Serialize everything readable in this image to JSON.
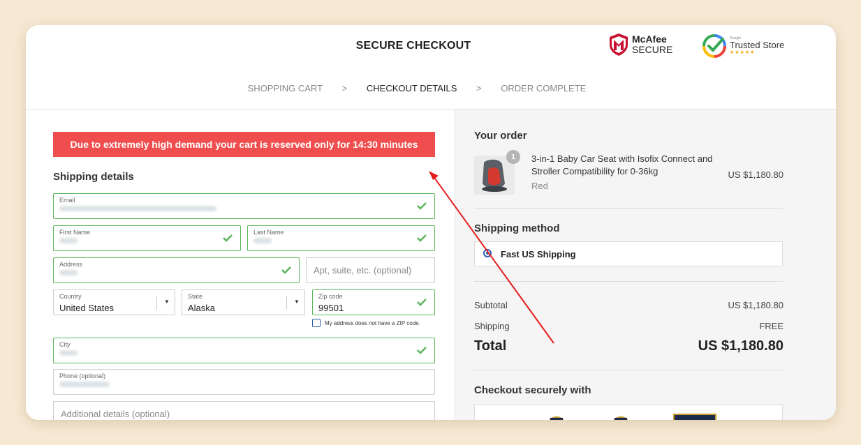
{
  "header": {
    "title": "SECURE CHECKOUT",
    "mcafee": {
      "line1": "McAfee",
      "line2": "SECURE",
      "icon": "mcafee-shield-icon"
    },
    "google": {
      "small": "Google",
      "line1": "Trusted Store",
      "stars": "★★★★★",
      "icon": "google-check-icon"
    }
  },
  "steps": [
    {
      "label": "SHOPPING CART"
    },
    {
      "label": ">"
    },
    {
      "label": "CHECKOUT DETAILS"
    },
    {
      "label": ">"
    },
    {
      "label": "ORDER COMPLETE"
    }
  ],
  "timer_text": "Due to extremely high demand your cart is reserved only for 14:30 minutes",
  "shipping": {
    "title": "Shipping details",
    "email_label": "Email",
    "first_name_label": "First Name",
    "last_name_label": "Last Name",
    "address_label": "Address",
    "apt_placeholder": "Apt, suite, etc. (optional)",
    "country_label": "Country",
    "country_value": "United States",
    "state_label": "State",
    "state_value": "Alaska",
    "zip_label": "Zip code",
    "zip_value": "99501",
    "no_zip_label": "My address does not have a ZIP code.",
    "city_label": "City",
    "phone_label": "Phone (optional)",
    "additional_placeholder": "Additional details (optional)"
  },
  "order": {
    "title": "Your order",
    "item_name": "3-in-1 Baby Car Seat with Isofix Connect and Stroller Compatibility for 0-36kg",
    "item_variant": "Red",
    "item_qty": "1",
    "item_price": "US $1,180.80",
    "shipping_method_title": "Shipping method",
    "shipping_option": "Fast US Shipping",
    "subtotal_label": "Subtotal",
    "subtotal_value": "US $1,180.80",
    "shipping_label": "Shipping",
    "shipping_value": "FREE",
    "total_label": "Total",
    "total_value": "US $1,180.80",
    "secure_title": "Checkout securely with"
  },
  "colors": {
    "timer_bg": "#f04e4e",
    "valid_border": "#5cb85c",
    "arrow": "#e51c1c",
    "background": "#f6e9d4"
  }
}
